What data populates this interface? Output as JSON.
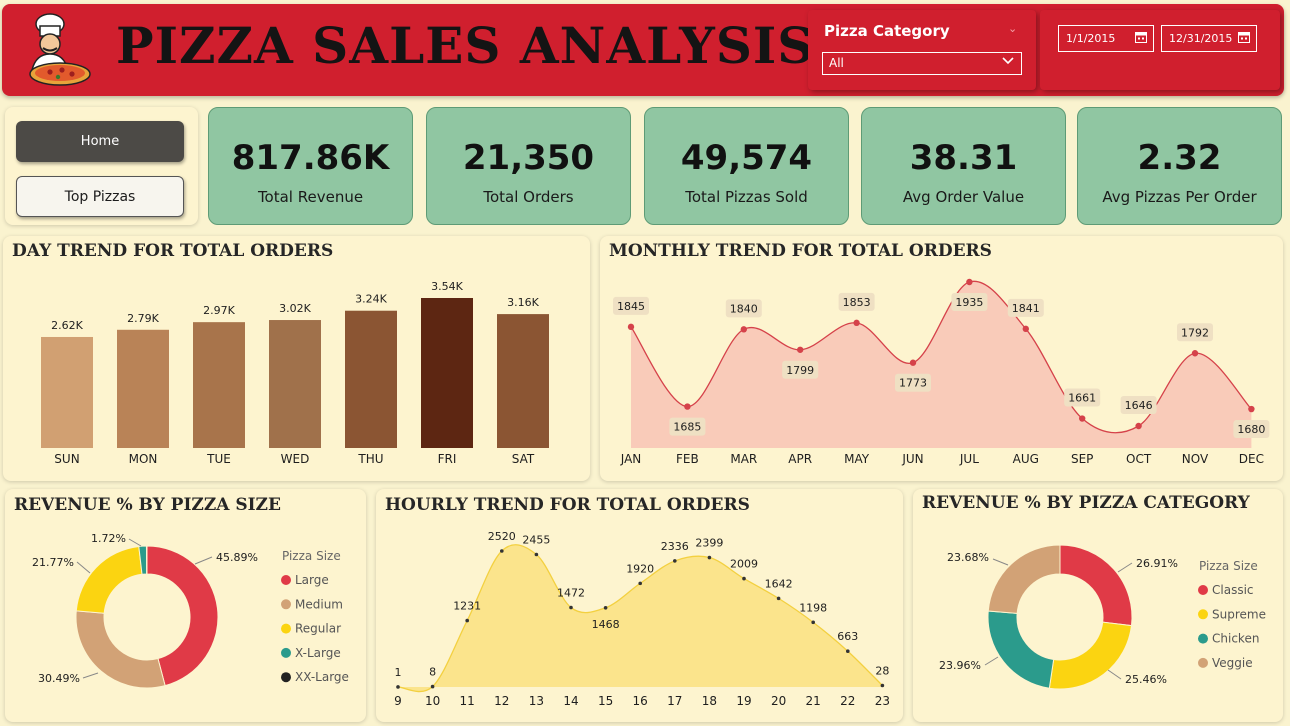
{
  "header": {
    "title": "PIZZA SALES ANALYSIS",
    "logo_icon": "chef-pizza-logo"
  },
  "filter": {
    "label": "Pizza Category",
    "selected": "All"
  },
  "dates": {
    "start": "1/1/2015",
    "end": "12/31/2015"
  },
  "nav": {
    "home": "Home",
    "top": "Top Pizzas"
  },
  "kpis": [
    {
      "value": "817.86K",
      "label": "Total Revenue"
    },
    {
      "value": "21,350",
      "label": "Total Orders"
    },
    {
      "value": "49,574",
      "label": "Total Pizzas Sold"
    },
    {
      "value": "38.31",
      "label": "Avg Order Value"
    },
    {
      "value": "2.32",
      "label": "Avg Pizzas Per Order"
    }
  ],
  "colors": {
    "header": "#d01f2e",
    "kpi": "#90c6a2",
    "panel": "#fdf4cf"
  },
  "chart_data": [
    {
      "type": "bar",
      "title": "DAY TREND FOR TOTAL ORDERS",
      "categories": [
        "SUN",
        "MON",
        "TUE",
        "WED",
        "THU",
        "FRI",
        "SAT"
      ],
      "values": [
        2620,
        2790,
        2970,
        3020,
        3240,
        3540,
        3160
      ],
      "labels": [
        "2.62K",
        "2.79K",
        "2.97K",
        "3.02K",
        "3.24K",
        "3.54K",
        "3.16K"
      ],
      "colors": [
        "#d1a072",
        "#b98357",
        "#a8744b",
        "#a0714b",
        "#8b5533",
        "#5d2612",
        "#8b5533"
      ]
    },
    {
      "type": "area",
      "title": "MONTHLY TREND FOR TOTAL ORDERS",
      "categories": [
        "JAN",
        "FEB",
        "MAR",
        "APR",
        "MAY",
        "JUN",
        "JUL",
        "AUG",
        "SEP",
        "OCT",
        "NOV",
        "DEC"
      ],
      "values": [
        1845,
        1685,
        1840,
        1799,
        1853,
        1773,
        1935,
        1841,
        1661,
        1646,
        1792,
        1680
      ]
    },
    {
      "type": "pie",
      "title": "REVENUE % BY PIZZA SIZE",
      "legend_title": "Pizza Size",
      "categories": [
        "Large",
        "Medium",
        "Regular",
        "X-Large",
        "XX-Large"
      ],
      "values": [
        45.89,
        30.49,
        21.77,
        1.72,
        0.12
      ],
      "labels": [
        "45.89%",
        "30.49%",
        "21.77%",
        "1.72%",
        ""
      ],
      "colors": [
        "#e03a47",
        "#d2a276",
        "#fbd411",
        "#2b9b8c",
        "#222222"
      ]
    },
    {
      "type": "area",
      "title": "HOURLY TREND FOR TOTAL ORDERS",
      "categories": [
        "9",
        "10",
        "11",
        "12",
        "13",
        "14",
        "15",
        "16",
        "17",
        "18",
        "19",
        "20",
        "21",
        "22",
        "23"
      ],
      "values": [
        1,
        8,
        1231,
        2520,
        2455,
        1472,
        1468,
        1920,
        2336,
        2399,
        2009,
        1642,
        1198,
        663,
        28
      ]
    },
    {
      "type": "pie",
      "title": "REVENUE % BY PIZZA CATEGORY",
      "legend_title": "Pizza Size",
      "categories": [
        "Classic",
        "Supreme",
        "Chicken",
        "Veggie"
      ],
      "values": [
        26.91,
        25.46,
        23.96,
        23.68
      ],
      "labels": [
        "26.91%",
        "25.46%",
        "23.96%",
        "23.68%"
      ],
      "colors": [
        "#e03a47",
        "#fbd411",
        "#2b9b8c",
        "#d2a276"
      ]
    }
  ]
}
